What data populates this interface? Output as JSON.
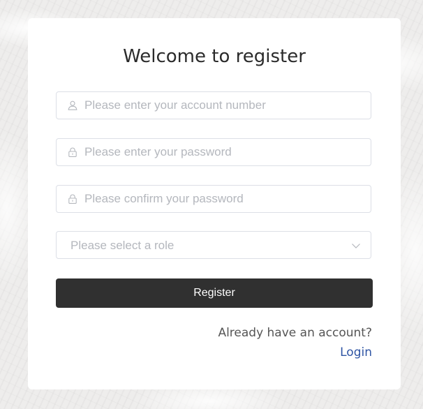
{
  "form": {
    "title": "Welcome to register",
    "account": {
      "icon": "user-icon",
      "placeholder": "Please enter your account number",
      "value": ""
    },
    "password": {
      "icon": "lock-icon",
      "placeholder": "Please enter your password",
      "value": ""
    },
    "confirm": {
      "icon": "lock-icon",
      "placeholder": "Please confirm your password",
      "value": ""
    },
    "role": {
      "placeholder": "Please select a role",
      "icon": "chevron-down-icon"
    },
    "register_label": "Register",
    "already_text": "Already have an account?",
    "login_label": "Login"
  },
  "colors": {
    "button_bg": "#303030",
    "link": "#2f55a4",
    "placeholder": "#b4b7bd",
    "border": "#dcdfe6"
  }
}
